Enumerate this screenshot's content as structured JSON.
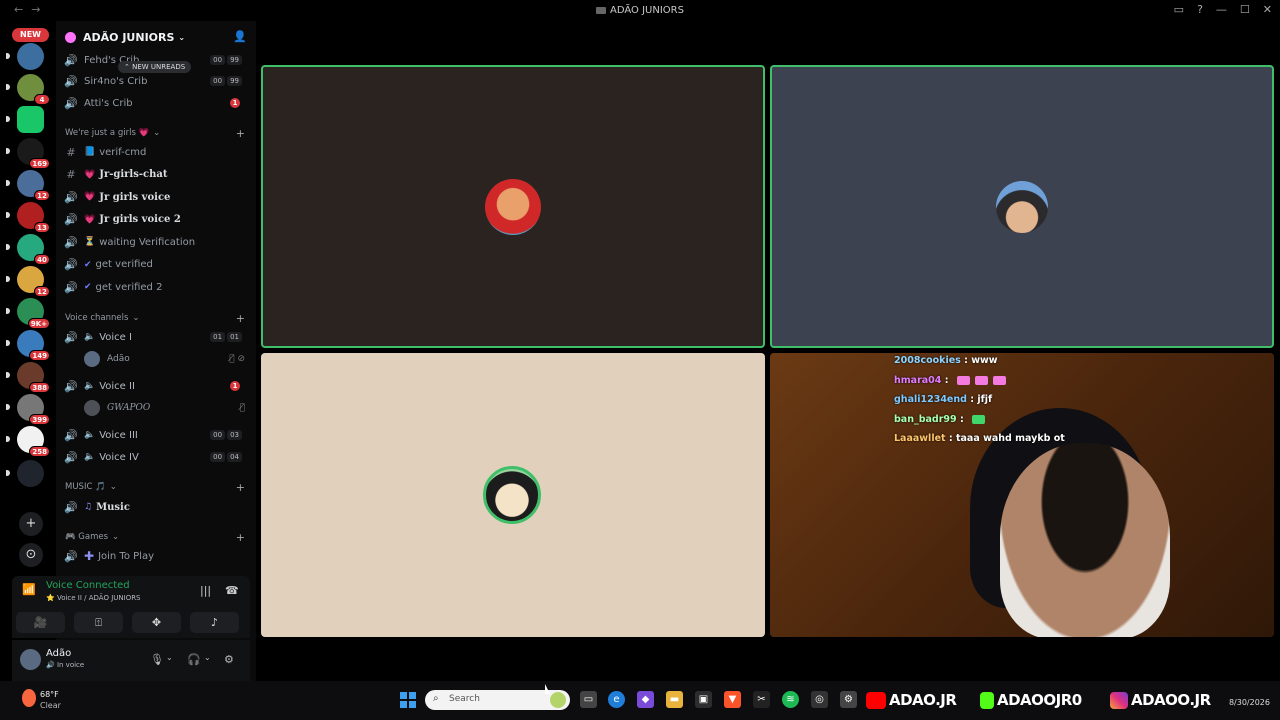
{
  "window": {
    "title": "ADÃO JUNIORS"
  },
  "rail": {
    "new_label": "NEW",
    "servers": [
      {
        "badge": "",
        "color": "#3d6ea0"
      },
      {
        "badge": "4",
        "color": "#6f8f3e"
      },
      {
        "badge": "",
        "color": "#19c769"
      },
      {
        "badge": "169",
        "color": "#1a1a1a"
      },
      {
        "badge": "12",
        "color": "#4a6d9a"
      },
      {
        "badge": "13",
        "color": "#b02020"
      },
      {
        "badge": "40",
        "color": "#27a980"
      },
      {
        "badge": "12",
        "color": "#d9a640"
      },
      {
        "badge": "9K+",
        "color": "#2b8f55"
      },
      {
        "badge": "149",
        "color": "#3a7bbd"
      },
      {
        "badge": "388",
        "color": "#6a3b2a"
      },
      {
        "badge": "399",
        "color": "#777777"
      },
      {
        "badge": "258",
        "color": "#f1f1f1"
      },
      {
        "badge": "",
        "color": "#20242c"
      }
    ]
  },
  "server": {
    "name": "ADÃO JUNIORS",
    "new_unreads": "NEW UNREADS"
  },
  "channels_top": [
    {
      "name": "Fehd's Crib",
      "c1": "00",
      "c2": "99"
    },
    {
      "name": "Sir4no's Crib",
      "c1": "00",
      "c2": "99"
    },
    {
      "name": "Atti's Crib",
      "red": "1"
    }
  ],
  "cat_girls": "We're just a girls 💗",
  "channels_girls": [
    {
      "icon": "#",
      "emoji": "📘",
      "name": "verif-cmd",
      "bright": false
    },
    {
      "icon": "#",
      "emoji": "💗",
      "name": "Jr-girls-chat",
      "bright": true
    },
    {
      "icon": "🔊",
      "emoji": "💗",
      "name": "Jr girls voice",
      "bright": true
    },
    {
      "icon": "🔊",
      "emoji": "💗",
      "name": "Jr girls voice 2",
      "bright": true
    },
    {
      "icon": "🔊",
      "emoji": "⏳",
      "name": "waiting Verification",
      "bright": false
    },
    {
      "icon": "🔊",
      "emoji": "✔",
      "name": "get verified",
      "bright": false
    },
    {
      "icon": "🔊",
      "emoji": "✔",
      "name": "get verified 2",
      "bright": false
    }
  ],
  "cat_voice": "Voice channels",
  "voice_channels": {
    "v1": {
      "name": "Voice I",
      "c1": "01",
      "c2": "01"
    },
    "v1_user": "Adão",
    "v2": {
      "name": "Voice II",
      "red": "1"
    },
    "v2_user": "GWAPOO",
    "v3": {
      "name": "Voice III",
      "c1": "00",
      "c2": "03"
    },
    "v4": {
      "name": "Voice IV",
      "c1": "00",
      "c2": "04"
    }
  },
  "cat_music": "MUSIC 🎵",
  "music_channel": "Music",
  "cat_games": "🎮 Games",
  "games_channel": "Join To Play",
  "voice_panel": {
    "status": "Voice Connected",
    "sub": "Voice II / ADÃO JUNIORS"
  },
  "user_panel": {
    "name": "Adão",
    "status": "In voice"
  },
  "stream_chat": [
    {
      "user": "2008cookies",
      "msg": "www",
      "emotes": 0
    },
    {
      "user": "hmara04",
      "msg": "",
      "emotes": 3
    },
    {
      "user": "ghali1234end",
      "msg": "jfjf",
      "emotes": 0
    },
    {
      "user": "ban_badr99",
      "msg": "",
      "emotes": 1
    },
    {
      "user": "Laaawllet",
      "msg": "taaa wahd maykb ot",
      "emotes": 0
    }
  ],
  "taskbar": {
    "temp": "68°F",
    "condition": "Clear",
    "search_placeholder": "Search",
    "socials": [
      "ADAO.JR",
      "ADAOOJR0",
      "ADAOO.JR"
    ],
    "date": "8/30/2026"
  },
  "colors": {
    "speaking_border": "#3fbf69",
    "voice_connected": "#23a55a",
    "badge_red": "#da373c"
  }
}
